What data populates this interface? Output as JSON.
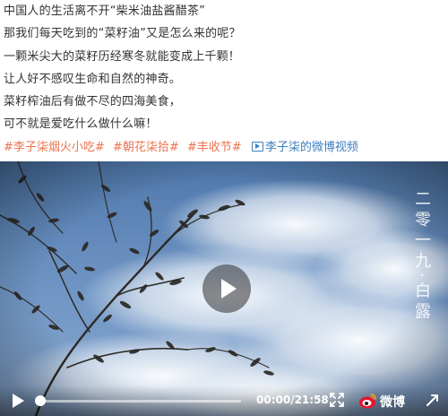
{
  "post": {
    "lines": [
      "中国人的生活离不开“柴米油盐酱醋茶”",
      "那我们每天吃到的“菜籽油”又是怎么来的呢？",
      "一颗米尖大的菜籽历经寒冬就能变成上千颗！",
      "让人好不感叹生命和自然的神奇。",
      "菜籽榨油后有做不尽的四海美食，",
      "可不就是爱吃什么做什么嘛！"
    ],
    "tags": [
      "#李子柒烟火小吃#",
      "#朝花柒拾#",
      "#丰收节#"
    ],
    "video_link": "李子柒的微博视频"
  },
  "colors": {
    "tag": "#eb7350",
    "link": "#3f7fbf",
    "sky": "#5f86b7"
  },
  "player": {
    "overlay_vertical_text": "二零一九·白露",
    "time": "00:00/21:58",
    "progress": 0,
    "brand": "微博",
    "icons": {
      "play": "play-icon",
      "fullscreen": "fullscreen-icon",
      "logo": "weibo-eye-icon",
      "speed": "speed-icon"
    }
  }
}
